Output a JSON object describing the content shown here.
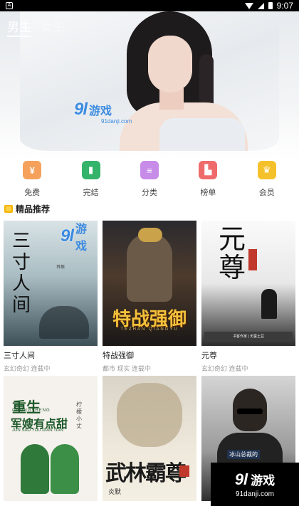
{
  "status_bar": {
    "time": "9:07",
    "app_icon": "A"
  },
  "banner": {
    "tabs": [
      {
        "label": "男生"
      },
      {
        "label": "女生"
      }
    ],
    "watermark_logo": "9l",
    "watermark_text": "游戏",
    "watermark_sub": "91danji.com"
  },
  "categories": [
    {
      "label": "免费",
      "icon": "free-icon",
      "color": "#f5a15b"
    },
    {
      "label": "完结",
      "icon": "book-complete-icon",
      "color": "#34b36a"
    },
    {
      "label": "分类",
      "icon": "category-icon",
      "color": "#c78be8"
    },
    {
      "label": "榜单",
      "icon": "ranking-icon",
      "color": "#ef6b6b"
    },
    {
      "label": "会员",
      "icon": "crown-icon",
      "color": "#f5c12b"
    }
  ],
  "section": {
    "title": "精品推荐"
  },
  "books": [
    {
      "title": "三寸人间",
      "meta": "玄幻奇幻 连载中",
      "cover_title": "三寸人间",
      "cover_author": "耳根"
    },
    {
      "title": "特战强御",
      "meta": "都市 现实 连载中",
      "cover_title": "特战强御",
      "cover_sub": "TEZHAN  QIANGYU"
    },
    {
      "title": "元尊",
      "meta": "玄幻奇幻 连载中",
      "cover_title": "元尊",
      "cover_bar": "书客作家 | 天蚕土豆"
    },
    {
      "title": "",
      "meta": "",
      "cover_title": "重生",
      "cover_title2": "军嫂有点甜",
      "cover_pinyin": "CHONGSHENG",
      "cover_pinyin2": "JUN SAO YOU DIAN TIAN",
      "cover_author": "柠檬小丈"
    },
    {
      "title": "",
      "meta": "",
      "cover_title": "武林霸尊",
      "cover_author": "炎默"
    },
    {
      "title": "",
      "meta": "",
      "cover_caption": "冰山总裁的"
    }
  ],
  "bottom_watermark": {
    "logo": "9l",
    "text": "游戏",
    "sub": "91danji.com"
  }
}
